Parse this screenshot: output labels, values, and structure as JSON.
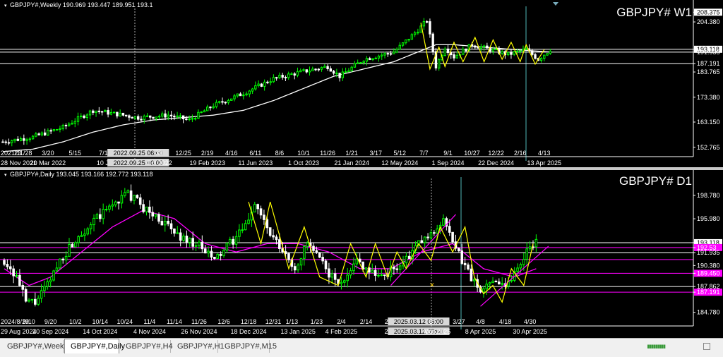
{
  "colors": {
    "bg": "#000000",
    "grid": "#ffffff",
    "bull": "#00ff00",
    "bear": "#ffffff",
    "ma_weekly": "#ffffff",
    "ma_daily": "#ff00ff",
    "zigzag": "#ffff00",
    "trend": "#ff00ff",
    "accent": "#0a7fff",
    "vline": "#4fb7b7"
  },
  "weekly": {
    "header": "GBPJPY#,Weekly  190.969 193.447 189.951 193.1",
    "watermark": "GBPJPY# W1",
    "price_labels": [
      "208.375",
      "204.380",
      "193.118",
      "191.935",
      "187.191",
      "183.765",
      "173.380",
      "163.150",
      "152.765"
    ],
    "price_values": [
      208.375,
      204.38,
      193.118,
      191.935,
      187.191,
      183.765,
      173.38,
      163.15,
      152.765
    ],
    "hlines": [
      193.118,
      191.935,
      187.191
    ],
    "ylim": [
      149.5,
      210.5
    ],
    "upper_dates": [
      {
        "t": "2021/11/28",
        "i": 0
      },
      {
        "t": "23",
        "i": 5
      },
      {
        "t": "3/20",
        "i": 15
      },
      {
        "t": "5/15",
        "i": 24
      },
      {
        "t": "7/10",
        "i": 34
      },
      {
        "t": "2022.09.25 06:00",
        "i": 45,
        "box": true
      },
      {
        "t": "30",
        "i": 52
      },
      {
        "t": "12/25",
        "i": 60
      },
      {
        "t": "2/19",
        "i": 68
      },
      {
        "t": "4/16",
        "i": 76
      },
      {
        "t": "6/11",
        "i": 84
      },
      {
        "t": "8/6",
        "i": 92
      },
      {
        "t": "10/1",
        "i": 100
      },
      {
        "t": "11/26",
        "i": 108
      },
      {
        "t": "1/21",
        "i": 116
      },
      {
        "t": "3/17",
        "i": 124
      },
      {
        "t": "5/12",
        "i": 132
      },
      {
        "t": "7/7",
        "i": 140
      },
      {
        "t": "9/1",
        "i": 148
      },
      {
        "t": "10/27",
        "i": 156
      },
      {
        "t": "12/22",
        "i": 164
      },
      {
        "t": "2/16",
        "i": 172
      },
      {
        "t": "4/13",
        "i": 180
      }
    ],
    "lower_dates": [
      {
        "t": "28 Nov 2021",
        "i": 0
      },
      {
        "t": "20 Mar 2022",
        "i": 15
      },
      {
        "t": "10 Jul",
        "i": 34
      },
      {
        "t": "2022.09.25 00:00",
        "i": 45,
        "box": true
      },
      {
        "t": "Oct 2022",
        "i": 52
      },
      {
        "t": "19 Feb 2023",
        "i": 68
      },
      {
        "t": "11 Jun 2023",
        "i": 84
      },
      {
        "t": "1 Oct 2023",
        "i": 100
      },
      {
        "t": "21 Jan 2024",
        "i": 116
      },
      {
        "t": "12 May 2024",
        "i": 132
      },
      {
        "t": "1 Sep 2024",
        "i": 148
      },
      {
        "t": "22 Dec 2024",
        "i": 164
      },
      {
        "t": "13 Apr 2025",
        "i": 180
      }
    ]
  },
  "daily": {
    "header": "GBPJPY#,Daily  193.045 193.166 192.772 193.118",
    "watermark": "GBPJPY# D1",
    "price_labels": [
      "198.780",
      "195.980",
      "193.118",
      "192.53",
      "191.935",
      "190.380",
      "189.450",
      "187.862",
      "187.191",
      "184.780"
    ],
    "price_values": [
      198.78,
      195.98,
      193.118,
      192.53,
      191.935,
      190.38,
      189.45,
      187.862,
      187.191,
      184.78
    ],
    "magenta_boxed": [
      "192.53",
      "191.1",
      "189.450",
      "187.191"
    ],
    "hlines_white": [
      193.118,
      191.935,
      187.862
    ],
    "hlines_magenta": [
      192.53,
      191.1,
      189.45,
      187.191
    ],
    "ylim": [
      183.4,
      200.8
    ],
    "upper_dates": [
      {
        "t": "2024/8/29",
        "i": 0
      },
      {
        "t": "9/10",
        "i": 8
      },
      {
        "t": "9/20",
        "i": 15
      },
      {
        "t": "10/2",
        "i": 23
      },
      {
        "t": "10/14",
        "i": 31
      },
      {
        "t": "10/24",
        "i": 39
      },
      {
        "t": "11/4",
        "i": 47
      },
      {
        "t": "11/14",
        "i": 55
      },
      {
        "t": "11/26",
        "i": 63
      },
      {
        "t": "12/6",
        "i": 71
      },
      {
        "t": "12/18",
        "i": 79
      },
      {
        "t": "12/31",
        "i": 87
      },
      {
        "t": "1/13",
        "i": 93
      },
      {
        "t": "1/23",
        "i": 101
      },
      {
        "t": "2/4",
        "i": 109
      },
      {
        "t": "2/14",
        "i": 117
      },
      {
        "t": "2/26",
        "i": 125
      },
      {
        "t": "2025.03.12 06:00",
        "i": 134,
        "box": true
      },
      {
        "t": "8",
        "i": 138
      },
      {
        "t": "3/27",
        "i": 147
      },
      {
        "t": "4/8",
        "i": 154
      },
      {
        "t": "4/18",
        "i": 162
      },
      {
        "t": "4/30",
        "i": 170
      }
    ],
    "lower_dates": [
      {
        "t": "29 Aug 2024",
        "i": 0
      },
      {
        "t": "20 Sep 2024",
        "i": 15
      },
      {
        "t": "14 Oct 2024",
        "i": 31
      },
      {
        "t": "4 Nov 2024",
        "i": 47
      },
      {
        "t": "26 Nov 2024",
        "i": 63
      },
      {
        "t": "18 Dec 2024",
        "i": 79
      },
      {
        "t": "13 Jan 2025",
        "i": 95
      },
      {
        "t": "4 Feb 2025",
        "i": 109
      },
      {
        "t": "26 F",
        "i": 125
      },
      {
        "t": "2025.03.12 00:00",
        "i": 134,
        "box": true
      },
      {
        "t": "Mar 2025",
        "i": 140
      },
      {
        "t": "8 Apr 2025",
        "i": 154
      },
      {
        "t": "30 Apr 2025",
        "i": 170
      }
    ]
  },
  "chart_data": [
    {
      "type": "candlestick",
      "title": "GBPJPY#,Weekly",
      "ylim": [
        149.5,
        210.5
      ],
      "close_path": [
        [
          0,
          155
        ],
        [
          10,
          157
        ],
        [
          20,
          161
        ],
        [
          30,
          168
        ],
        [
          40,
          166
        ],
        [
          45,
          165
        ],
        [
          55,
          166
        ],
        [
          62,
          164
        ],
        [
          70,
          170
        ],
        [
          80,
          175
        ],
        [
          90,
          181
        ],
        [
          100,
          184
        ],
        [
          108,
          186
        ],
        [
          112,
          182
        ],
        [
          120,
          189
        ],
        [
          130,
          192
        ],
        [
          138,
          201
        ],
        [
          141,
          205
        ],
        [
          144,
          186
        ],
        [
          147,
          194
        ],
        [
          150,
          190
        ],
        [
          156,
          195
        ],
        [
          162,
          193
        ],
        [
          168,
          191
        ],
        [
          174,
          193
        ],
        [
          178,
          189
        ],
        [
          182,
          193
        ]
      ],
      "ma_path": [
        [
          0,
          151
        ],
        [
          10,
          152
        ],
        [
          20,
          155
        ],
        [
          30,
          159
        ],
        [
          40,
          162
        ],
        [
          50,
          164
        ],
        [
          60,
          165
        ],
        [
          70,
          166
        ],
        [
          80,
          168
        ],
        [
          90,
          172
        ],
        [
          100,
          177
        ],
        [
          110,
          182
        ],
        [
          120,
          185
        ],
        [
          130,
          188
        ],
        [
          138,
          192
        ],
        [
          144,
          195
        ],
        [
          150,
          195
        ],
        [
          160,
          194
        ],
        [
          170,
          193
        ],
        [
          182,
          192
        ]
      ],
      "zigzag": [
        [
          139,
          204
        ],
        [
          142,
          185
        ],
        [
          145,
          194
        ],
        [
          147,
          186
        ],
        [
          150,
          196
        ],
        [
          153,
          188
        ],
        [
          157,
          198
        ],
        [
          160,
          188
        ],
        [
          163,
          197
        ],
        [
          166,
          189
        ],
        [
          169,
          196
        ],
        [
          172,
          188
        ],
        [
          174,
          195
        ],
        [
          177,
          187
        ],
        [
          180,
          193
        ]
      ]
    },
    {
      "type": "candlestick",
      "title": "GBPJPY#,Daily",
      "ylim": [
        183.4,
        200.8
      ],
      "close_path": [
        [
          0,
          191
        ],
        [
          4,
          189
        ],
        [
          7,
          186
        ],
        [
          10,
          186
        ],
        [
          14,
          188
        ],
        [
          18,
          191
        ],
        [
          24,
          194
        ],
        [
          30,
          196
        ],
        [
          36,
          198
        ],
        [
          40,
          199
        ],
        [
          46,
          197
        ],
        [
          50,
          196
        ],
        [
          56,
          194
        ],
        [
          62,
          193
        ],
        [
          68,
          191
        ],
        [
          73,
          193
        ],
        [
          78,
          195
        ],
        [
          81,
          198
        ],
        [
          86,
          194
        ],
        [
          90,
          192
        ],
        [
          94,
          190
        ],
        [
          98,
          193
        ],
        [
          102,
          191
        ],
        [
          106,
          189
        ],
        [
          109,
          188
        ],
        [
          113,
          191
        ],
        [
          118,
          190
        ],
        [
          122,
          189
        ],
        [
          126,
          190
        ],
        [
          130,
          191
        ],
        [
          134,
          193
        ],
        [
          138,
          194
        ],
        [
          142,
          196
        ],
        [
          145,
          193
        ],
        [
          148,
          191
        ],
        [
          151,
          189
        ],
        [
          154,
          187
        ],
        [
          158,
          189
        ],
        [
          162,
          188
        ],
        [
          166,
          190
        ],
        [
          170,
          193
        ],
        [
          172,
          193.1
        ]
      ],
      "ma_path": [
        [
          0,
          190
        ],
        [
          8,
          188
        ],
        [
          15,
          189
        ],
        [
          25,
          192
        ],
        [
          35,
          195
        ],
        [
          45,
          197
        ],
        [
          55,
          196
        ],
        [
          65,
          193
        ],
        [
          75,
          192
        ],
        [
          85,
          193
        ],
        [
          95,
          193
        ],
        [
          105,
          192
        ],
        [
          115,
          190
        ],
        [
          125,
          190
        ],
        [
          135,
          192
        ],
        [
          145,
          193
        ],
        [
          155,
          190
        ],
        [
          165,
          189
        ],
        [
          172,
          190
        ]
      ],
      "zigzag": [
        [
          79,
          198
        ],
        [
          83,
          193
        ],
        [
          86,
          198
        ],
        [
          92,
          190
        ],
        [
          97,
          195
        ],
        [
          102,
          189
        ],
        [
          108,
          188
        ],
        [
          112,
          193
        ],
        [
          117,
          189
        ],
        [
          120,
          193
        ],
        [
          124,
          189
        ],
        [
          127,
          192
        ],
        [
          130,
          190
        ],
        [
          134,
          193
        ],
        [
          138,
          191
        ],
        [
          141,
          195
        ],
        [
          145,
          192
        ],
        [
          149,
          195
        ],
        [
          152,
          189
        ],
        [
          155,
          187
        ],
        [
          158,
          188
        ],
        [
          161,
          186
        ],
        [
          164,
          190
        ],
        [
          168,
          188
        ],
        [
          171,
          193
        ]
      ],
      "trendlines": [
        [
          [
            125,
            188
          ],
          [
            146,
            196.5
          ]
        ],
        [
          [
            154,
            185.5
          ],
          [
            176,
            192.7
          ]
        ]
      ]
    }
  ],
  "tabs": [
    "GBPJPY#,Weekly",
    "GBPJPY#,Daily",
    "GBPJPY#,H4",
    "GBPJPY#,H1",
    "GBPJPY#,M15"
  ],
  "active_tab": 1
}
